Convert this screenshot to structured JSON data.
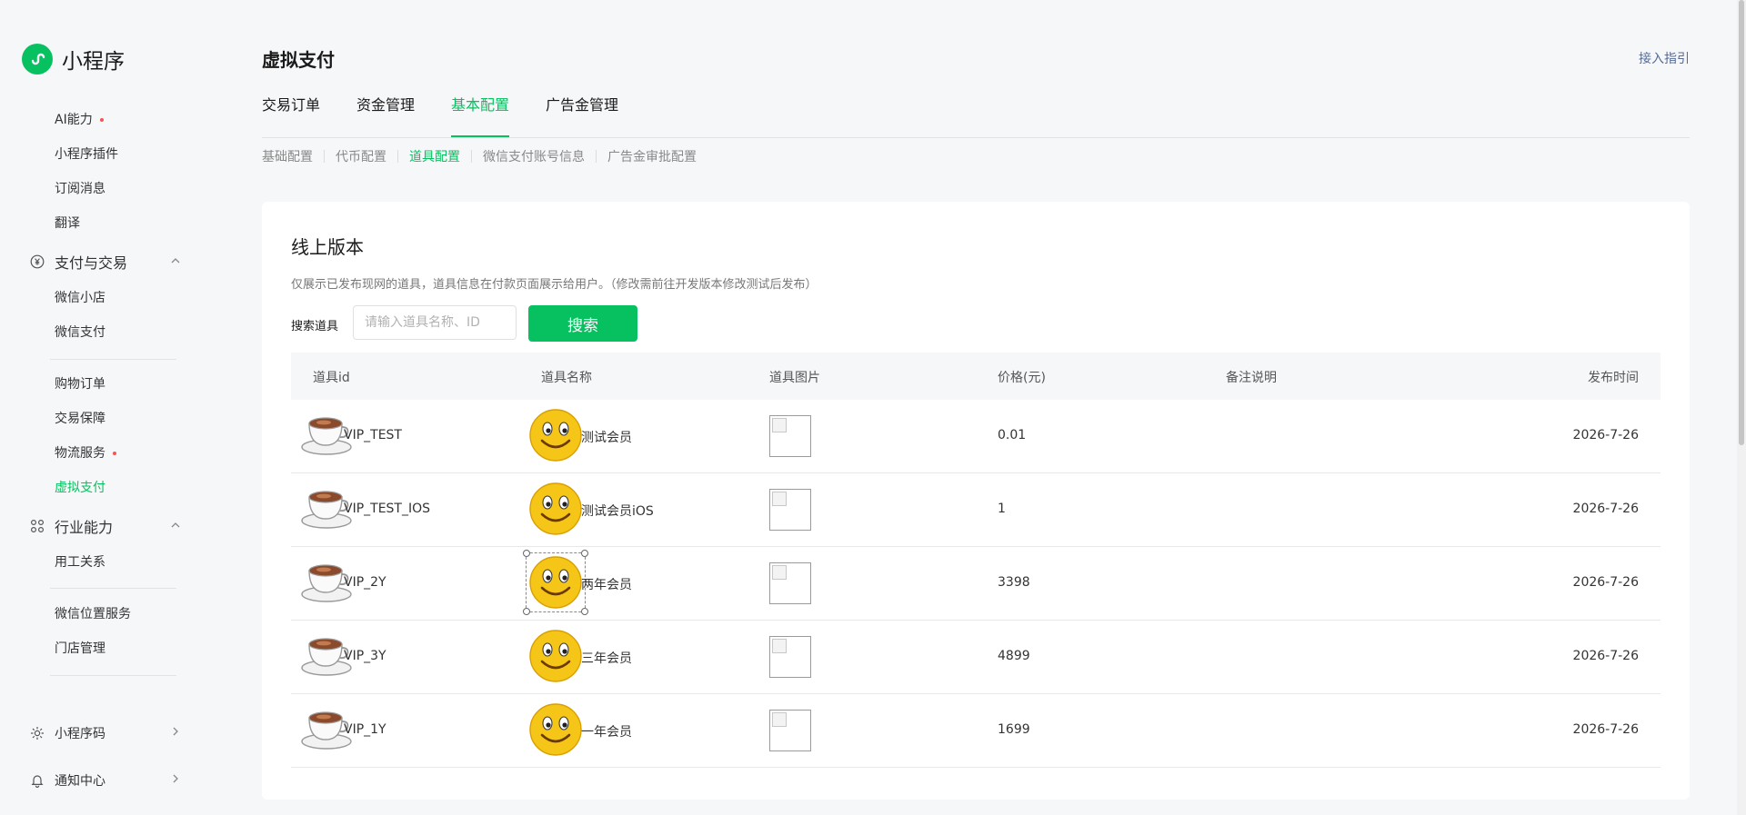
{
  "brand": {
    "name": "小程序"
  },
  "sidebar": {
    "items": [
      {
        "label": "AI能力",
        "dot": true
      },
      {
        "label": "小程序插件"
      },
      {
        "label": "订阅消息"
      },
      {
        "label": "翻译"
      },
      {
        "label": "微信小店"
      },
      {
        "label": "微信支付"
      },
      {
        "label": "购物订单"
      },
      {
        "label": "交易保障"
      },
      {
        "label": "物流服务",
        "dot": true
      },
      {
        "label": "虚拟支付",
        "active": true
      },
      {
        "label": "用工关系"
      },
      {
        "label": "微信位置服务"
      },
      {
        "label": "门店管理"
      }
    ],
    "groups": [
      {
        "label": "支付与交易",
        "icon": "yen-icon"
      },
      {
        "label": "行业能力",
        "icon": "industry-icon"
      }
    ],
    "bottom": [
      {
        "label": "小程序码",
        "icon": "qrcode-icon"
      },
      {
        "label": "通知中心",
        "icon": "bell-icon"
      }
    ]
  },
  "header": {
    "title": "虚拟支付",
    "guide_link": "接入指引"
  },
  "tabs": [
    {
      "label": "交易订单"
    },
    {
      "label": "资金管理"
    },
    {
      "label": "基本配置",
      "active": true
    },
    {
      "label": "广告金管理"
    }
  ],
  "subtabs": [
    {
      "label": "基础配置"
    },
    {
      "label": "代币配置"
    },
    {
      "label": "道具配置",
      "active": true
    },
    {
      "label": "微信支付账号信息"
    },
    {
      "label": "广告金审批配置"
    }
  ],
  "card": {
    "title": "线上版本",
    "description": "仅展示已发布现网的道具，道具信息在付款页面展示给用户。（修改需前往开发版本修改测试后发布）",
    "search": {
      "label": "搜索道具",
      "placeholder": "请输入道具名称、ID",
      "value": "",
      "button": "搜索"
    }
  },
  "table": {
    "columns": [
      "道具id",
      "道具名称",
      "道具图片",
      "价格(元)",
      "备注说明",
      "发布时间"
    ],
    "rows": [
      {
        "id": "VIP_TEST",
        "name": "测试会员",
        "price": "0.01",
        "note": "",
        "time": "2026-7-26"
      },
      {
        "id": "VIP_TEST_IOS",
        "name": "测试会员iOS",
        "price": "1",
        "note": "",
        "time": "2026-7-26"
      },
      {
        "id": "VIP_2Y",
        "name": "两年会员",
        "price": "3398",
        "note": "",
        "time": "2026-7-26"
      },
      {
        "id": "VIP_3Y",
        "name": "三年会员",
        "price": "4899",
        "note": "",
        "time": "2026-7-26"
      },
      {
        "id": "VIP_1Y",
        "name": "一年会员",
        "price": "1699",
        "note": "",
        "time": "2026-7-26"
      }
    ]
  },
  "colors": {
    "accent": "#07c160",
    "link": "#576b95",
    "badge_dot": "#fa5151"
  }
}
